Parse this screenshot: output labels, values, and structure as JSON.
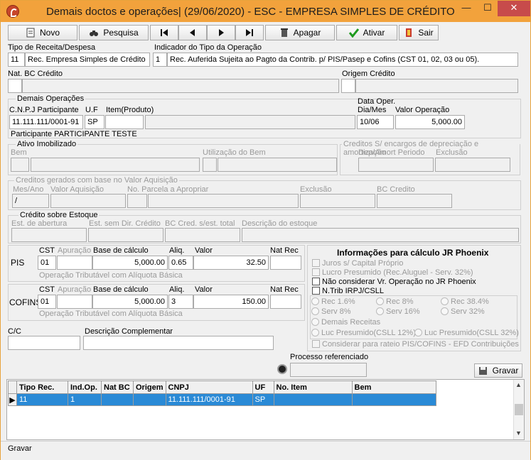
{
  "window": {
    "title": "Demais doctos e operações| (29/06/2020) - ESC - EMPRESA SIMPLES DE CRÉDITO",
    "min": "—",
    "max": "☐",
    "close": "✕"
  },
  "toolbar": {
    "novo": "Novo",
    "pesquisa": "Pesquisa",
    "apagar": "Apagar",
    "ativar": "Ativar",
    "sair": "Sair"
  },
  "tipo_receita": {
    "label": "Tipo de Receita/Despesa",
    "code": "11",
    "desc": "Rec. Empresa Simples de Crédito"
  },
  "indicador": {
    "label": "Indicador do Tipo da Operação",
    "code": "1",
    "desc": "Rec. Auferida Sujeita ao Pagto da Contrib. p/ PIS/Pasep e Cofins (CST 01, 02, 03 ou 05)."
  },
  "nat_bc": {
    "label": "Nat. BC Crédito"
  },
  "origem": {
    "label": "Origem Crédito"
  },
  "demais": {
    "title": "Demais Operações",
    "cnpj_label": "C.N.P.J Participante",
    "uf_label": "U.F",
    "item_label": "Item(Produto)",
    "data_label1": "Data Oper.",
    "data_label2": "Dia/Mes",
    "valor_label": "Valor Operação",
    "cnpj": "11.111.111/0001-91",
    "uf": "SP",
    "data": "10/06",
    "valor": "5,000.00",
    "participante": "Participante PARTICIPANTE TESTE"
  },
  "ativo": {
    "title": "Ativo Imobilizado",
    "bem": "Bem",
    "utilizacao": "Utilização do Bem"
  },
  "creditos_enc": {
    "title": "Creditos S/ encargos de depreciação e amortização",
    "dep": "Dep/Amort Periodo",
    "exclusao": "Exclusão"
  },
  "creditos_aq": {
    "title": "Creditos gerados com base no Valor Aquisição",
    "mes": "Mes/Ano",
    "valor_aq": "Valor Aquisição",
    "parcela": "No. Parcela a Apropriar",
    "exclusao": "Exclusão",
    "bc": "BC Credito",
    "mes_val": "/"
  },
  "estoque": {
    "title": "Crédito sobre Estoque",
    "abertura": "Est. de abertura",
    "sem_dir": "Est. sem Dir. Crédito",
    "bc_total": "BC Cred. s/est. total",
    "descricao": "Descrição do estoque"
  },
  "pis": {
    "name": "PIS",
    "cst_label": "CST",
    "apur_label": "Apuração",
    "base_label": "Base de cálculo",
    "aliq_label": "Aliq.",
    "valor_label": "Valor",
    "nat_label": "Nat Rec",
    "cst": "01",
    "base": "5,000.00",
    "aliq": "0.65",
    "valor": "32.50",
    "desc": "Operação Tributável com Alíquota Básica"
  },
  "cofins": {
    "name": "COFINS",
    "cst_label": "CST",
    "apur_label": "Apuração",
    "base_label": "Base de cálculo",
    "aliq_label": "Aliq.",
    "valor_label": "Valor",
    "nat_label": "Nat Rec",
    "cst": "01",
    "base": "5,000.00",
    "aliq": "3",
    "valor": "150.00",
    "desc": "Operação Tributável com Alíquota Básica"
  },
  "jr": {
    "title": "Informações para cálculo JR Phoenix",
    "juros": "Juros s/ Capital Próprio",
    "lucro": "Lucro Presumido (Rec.Aluguel - Serv. 32%)",
    "nao_considerar": "Não considerar Vr. Operação no JR Phoenix",
    "ntrib": "N.Trib IRPJ/CSLL",
    "radios": [
      "Rec 1.6%",
      "Rec 8%",
      "Rec 38.4%",
      "Serv 8%",
      "Serv 16%",
      "Serv 32%",
      "Demais Receitas",
      "Luc Presumido(CSLL 12%)",
      "Luc Presumido(CSLL 32%)"
    ],
    "rateio": "Considerar para rateio PIS/COFINS - EFD Contribuições"
  },
  "cc": {
    "label": "C/C"
  },
  "desc_comp": {
    "label": "Descrição Complementar"
  },
  "processo": {
    "label": "Processo referenciado"
  },
  "gravar": "Gravar",
  "grid": {
    "headers": [
      "Tipo Rec.",
      "Ind.Op.",
      "Nat BC",
      "Origem",
      "CNPJ",
      "UF",
      "No. Item",
      "Bem"
    ],
    "row": [
      "11",
      "1",
      "",
      "",
      "11.111.111/0001-91",
      "SP",
      "",
      ""
    ]
  },
  "status": "Gravar"
}
